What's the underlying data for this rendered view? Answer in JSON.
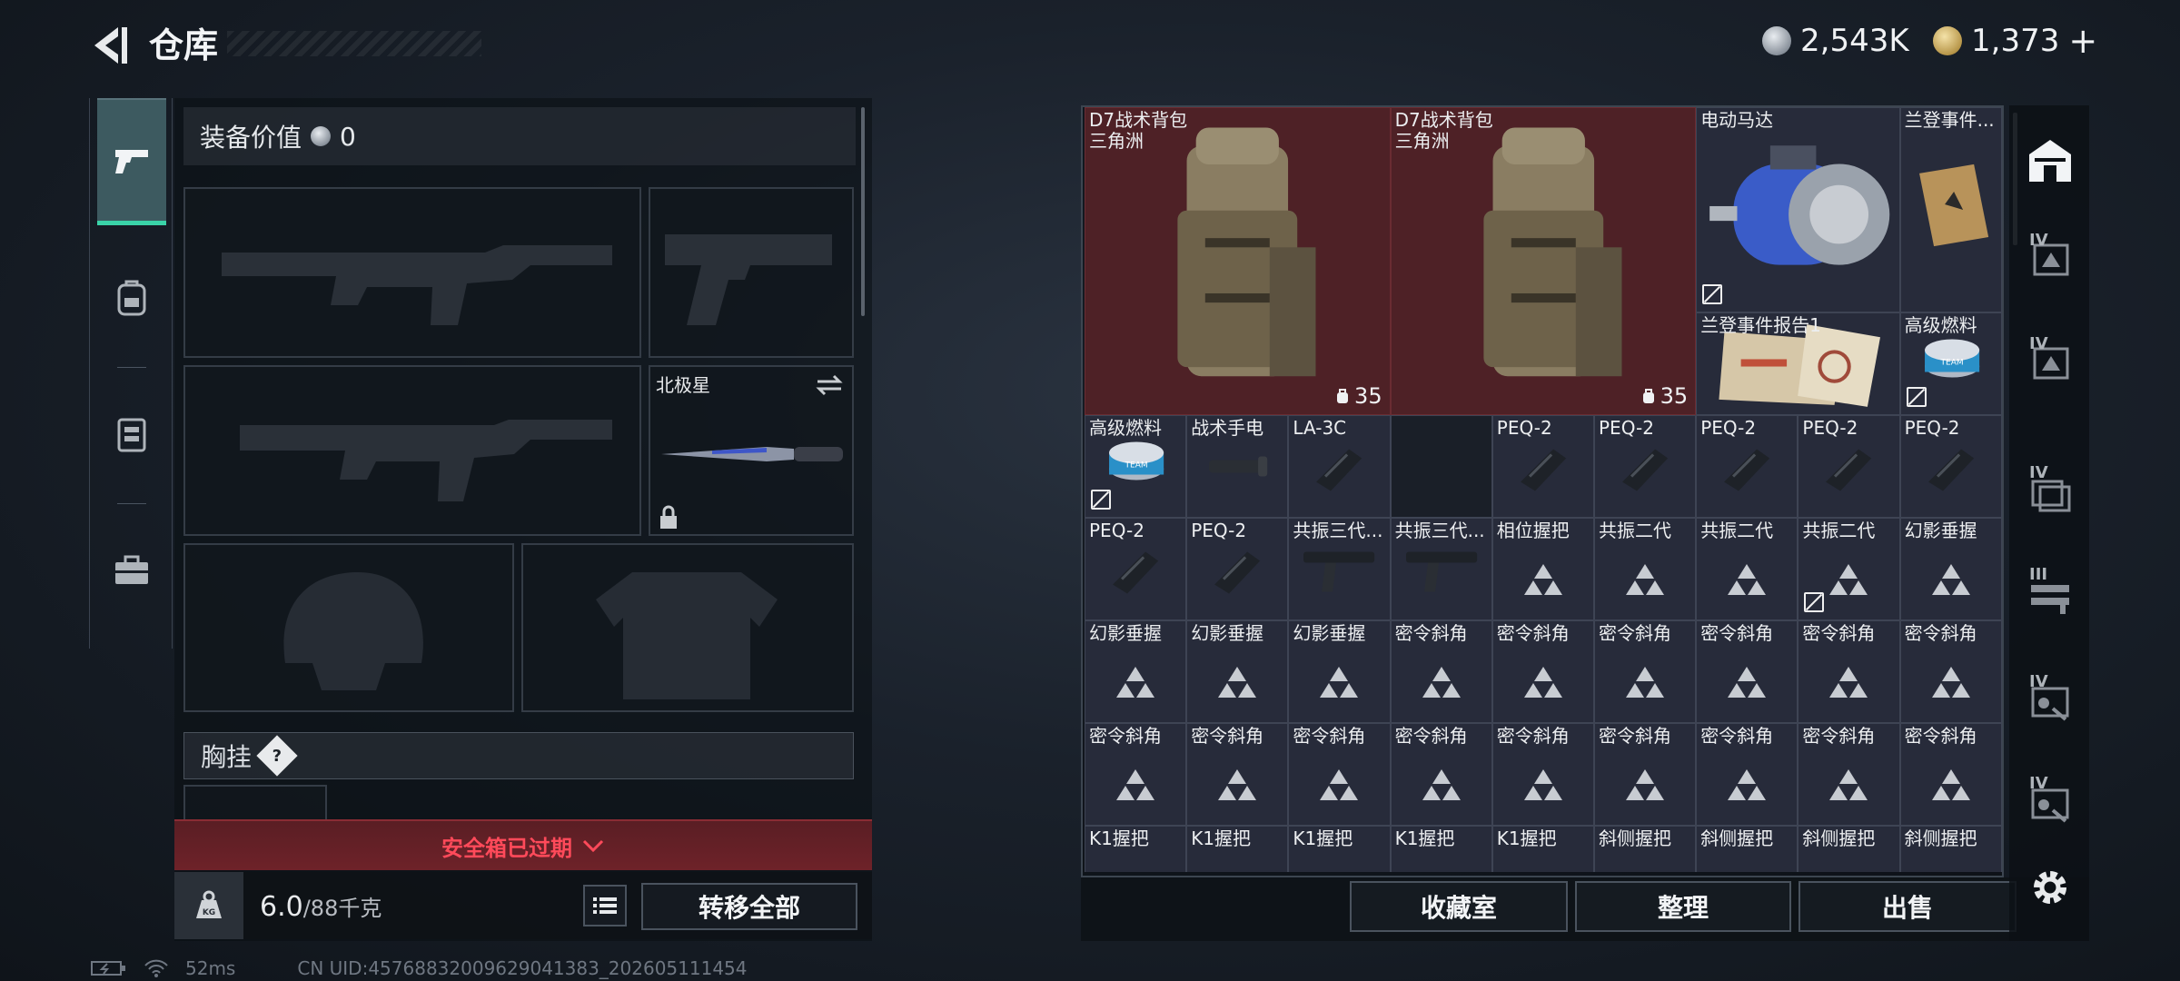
{
  "header": {
    "title": "仓库"
  },
  "currency": [
    {
      "icon": "silver-coin-icon",
      "value": "2,543K"
    },
    {
      "icon": "gold-coin-icon",
      "value": "1,373",
      "add": "+"
    }
  ],
  "left_tabs": [
    {
      "icon": "pistol-icon",
      "active": true
    },
    {
      "icon": "backpack-icon",
      "active": false
    },
    {
      "icon": "chest-rig-icon",
      "active": false
    },
    {
      "icon": "toolbox-icon",
      "active": false
    }
  ],
  "loadout": {
    "equip_value_label": "装备价值",
    "equip_value": "0",
    "melee_slot_name": "北极星",
    "vest_label": "胸挂",
    "vest_help": "?",
    "safe_box_text": "安全箱已过期",
    "weight_current": "6.0",
    "weight_max": "/88千克",
    "transfer_all": "转移全部"
  },
  "storage": {
    "cells": [
      {
        "name": "D7战术背包",
        "sub": "三角洲",
        "style": "red",
        "capacity": "35"
      },
      {
        "name": "D7战术背包",
        "sub": "三角洲",
        "style": "red",
        "capacity": "35"
      },
      {
        "name": "电动马达"
      },
      {
        "name": "兰登事件..."
      },
      {
        "name": "兰登事件报告1"
      },
      {
        "name": "高级燃料"
      },
      {
        "name": "高级燃料"
      },
      {
        "name": "战术手电"
      },
      {
        "name": "LA-3C"
      },
      {
        "name": "PEQ-2"
      },
      {
        "name": "PEQ-2"
      },
      {
        "name": "PEQ-2"
      },
      {
        "name": "PEQ-2"
      },
      {
        "name": "PEQ-2"
      },
      {
        "name": "PEQ-2"
      },
      {
        "name": "PEQ-2"
      },
      {
        "name": "共振三代..."
      },
      {
        "name": "共振三代..."
      },
      {
        "name": "相位握把"
      },
      {
        "name": "共振二代"
      },
      {
        "name": "共振二代"
      },
      {
        "name": "共振二代"
      },
      {
        "name": "幻影垂握"
      },
      {
        "name": "幻影垂握"
      },
      {
        "name": "幻影垂握"
      },
      {
        "name": "幻影垂握"
      },
      {
        "name": "密令斜角"
      },
      {
        "name": "密令斜角"
      },
      {
        "name": "密令斜角"
      },
      {
        "name": "密令斜角"
      },
      {
        "name": "密令斜角"
      },
      {
        "name": "密令斜角"
      },
      {
        "name": "密令斜角"
      },
      {
        "name": "密令斜角"
      },
      {
        "name": "密令斜角"
      },
      {
        "name": "密令斜角"
      },
      {
        "name": "密令斜角"
      },
      {
        "name": "密令斜角"
      },
      {
        "name": "密令斜角"
      },
      {
        "name": "密令斜角"
      },
      {
        "name": "密令斜角"
      },
      {
        "name": "K1握把"
      },
      {
        "name": "K1握把"
      },
      {
        "name": "K1握把"
      },
      {
        "name": "K1握把"
      },
      {
        "name": "K1握把"
      },
      {
        "name": "斜侧握把"
      },
      {
        "name": "斜侧握把"
      },
      {
        "name": "斜侧握把"
      },
      {
        "name": "斜侧握把"
      }
    ],
    "buttons": {
      "collection": "收藏室",
      "organize": "整理",
      "sell": "出售"
    }
  },
  "right_tabs": [
    {
      "icon": "home-storage-icon",
      "tier": ""
    },
    {
      "icon": "helmet-container-icon",
      "tier": "IV"
    },
    {
      "icon": "helmet-container-icon",
      "tier": "IV"
    },
    {
      "icon": "stack-container-icon",
      "tier": "IV"
    },
    {
      "icon": "rack-container-icon",
      "tier": "III"
    },
    {
      "icon": "tool-container-icon",
      "tier": "IV"
    },
    {
      "icon": "tool-container-icon",
      "tier": "IV"
    }
  ],
  "status_bar": {
    "ping": "52ms",
    "uid": "CN UID:4576883200962904138​3_202605111454"
  },
  "colors": {
    "accent": "#3ad3a8",
    "alert": "#ff4a5a",
    "cell": "#272b3a",
    "cell_red": "#4e2126"
  }
}
